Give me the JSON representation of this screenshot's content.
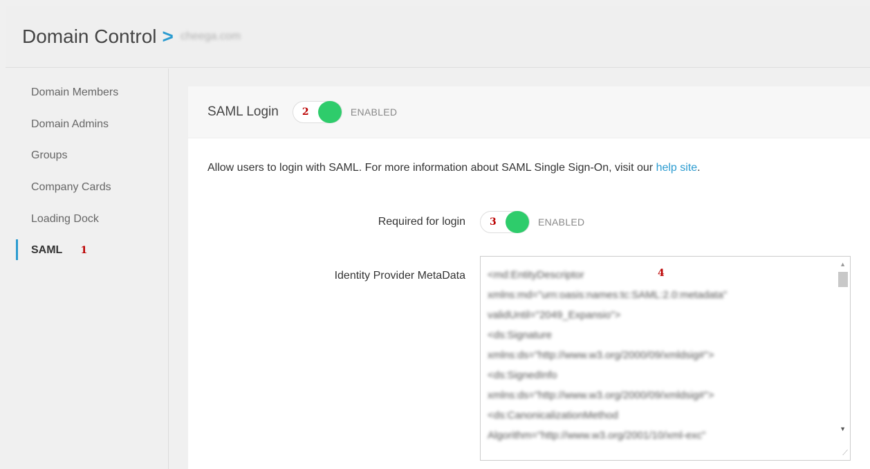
{
  "header": {
    "title": "Domain Control",
    "separator": ">",
    "domain": "cheega.com"
  },
  "sidebar": {
    "items": [
      {
        "label": "Domain Members"
      },
      {
        "label": "Domain Admins"
      },
      {
        "label": "Groups"
      },
      {
        "label": "Company Cards"
      },
      {
        "label": "Loading Dock"
      },
      {
        "label": "SAML",
        "active": true,
        "annotation": "1"
      }
    ]
  },
  "saml": {
    "title": "SAML Login",
    "toggle_annotation": "2",
    "toggle_state": "ENABLED",
    "description": "Allow users to login with SAML. For more information about SAML Single Sign-On, visit our ",
    "help_link": "help site",
    "description_end": ".",
    "required": {
      "label": "Required for login",
      "annotation": "3",
      "state": "ENABLED"
    },
    "metadata": {
      "label": "Identity Provider MetaData",
      "annotation": "4",
      "lines": [
        "<md:EntityDescriptor",
        "xmlns:md=\"urn:oasis:names:tc:SAML:2.0:metadata\"",
        "validUntil=\"2049_Expansio\">",
        "<ds:Signature",
        "xmlns:ds=\"http://www.w3.org/2000/09/xmldsig#\">",
        "<ds:SignedInfo",
        "xmlns:ds=\"http://www.w3.org/2000/09/xmldsig#\">",
        "<ds:CanonicalizationMethod",
        "Algorithm=\"http://www.w3.org/2001/10/xml-exc\""
      ]
    }
  },
  "colors": {
    "accent": "#2a9bd0",
    "toggle_on": "#2ecc6b",
    "annotation": "#bb0000"
  }
}
